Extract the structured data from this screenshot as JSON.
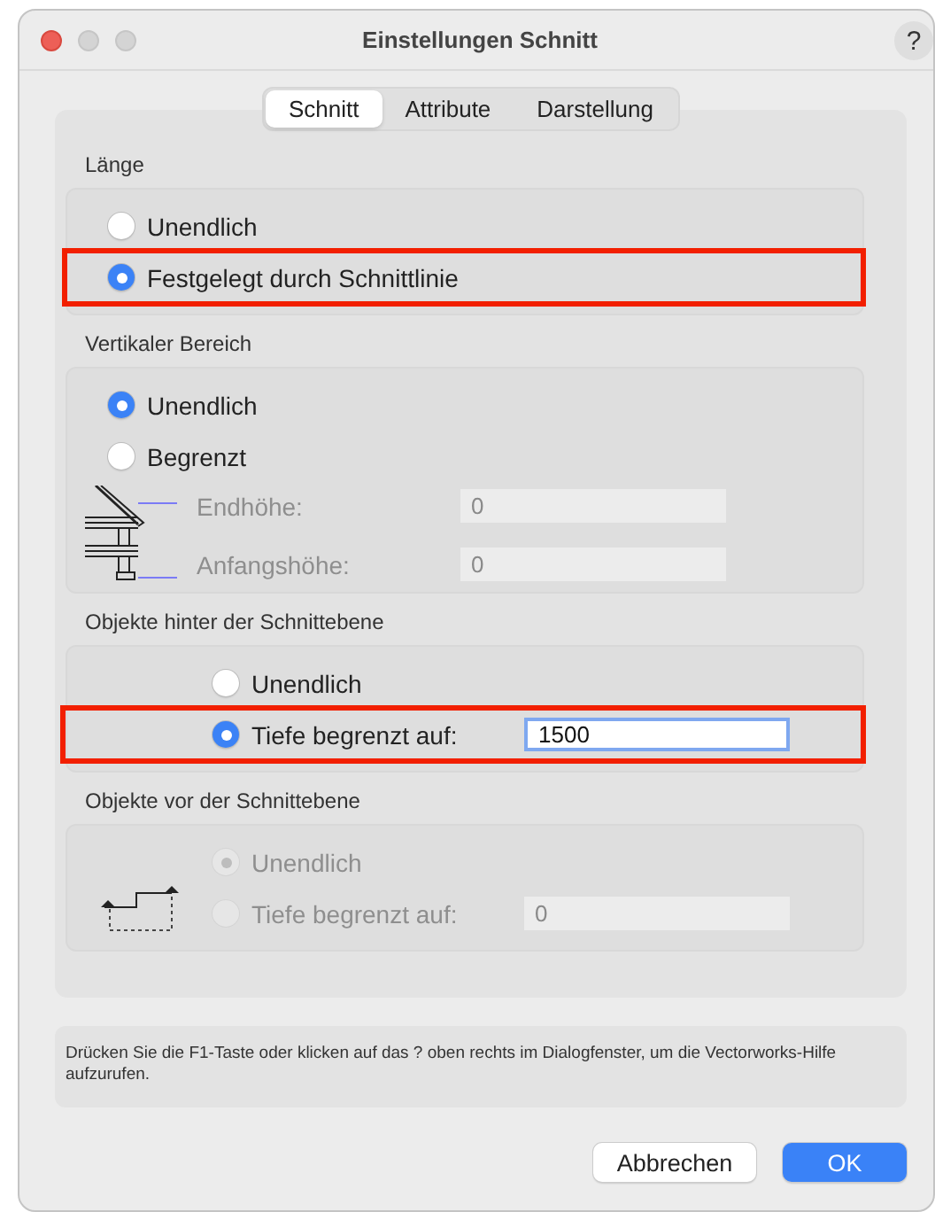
{
  "window": {
    "title": "Einstellungen Schnitt",
    "help_button": "?"
  },
  "tabs": [
    {
      "label": "Schnitt",
      "selected": true
    },
    {
      "label": "Attribute",
      "selected": false
    },
    {
      "label": "Darstellung",
      "selected": false
    }
  ],
  "sections": [
    {
      "label": "Länge",
      "kind": "plain",
      "options": [
        {
          "kind": "radio",
          "label": "Unendlich",
          "selected": false,
          "disabled": false,
          "highlighted": false
        },
        {
          "kind": "radio",
          "label": "Festgelegt durch Schnittlinie",
          "selected": true,
          "disabled": false,
          "highlighted": true
        }
      ]
    },
    {
      "label": "Vertikaler Bereich",
      "kind": "building",
      "options": [
        {
          "kind": "radio",
          "label": "Unendlich",
          "selected": true,
          "disabled": false,
          "highlighted": false
        },
        {
          "kind": "radio",
          "label": "Begrenzt",
          "selected": false,
          "disabled": false,
          "highlighted": false
        },
        {
          "kind": "field",
          "label": "Endhöhe:",
          "value": "0",
          "disabled": true,
          "focused": false,
          "highlighted": false
        },
        {
          "kind": "field",
          "label": "Anfangshöhe:",
          "value": "0",
          "disabled": true,
          "focused": false,
          "highlighted": false
        }
      ]
    },
    {
      "label": "Objekte hinter der Schnittebene",
      "kind": "indented",
      "options": [
        {
          "kind": "radio",
          "label": "Unendlich",
          "selected": false,
          "disabled": false,
          "highlighted": false
        },
        {
          "kind": "radio_field",
          "label": "Tiefe begrenzt auf:",
          "selected": true,
          "disabled": false,
          "value": "1500",
          "focused": true,
          "highlighted": true
        }
      ]
    },
    {
      "label": "Objekte vor der Schnittebene",
      "kind": "step",
      "options": [
        {
          "kind": "radio",
          "label": "Unendlich",
          "selected": true,
          "disabled": true,
          "highlighted": false
        },
        {
          "kind": "radio_field",
          "label": "Tiefe begrenzt auf:",
          "selected": false,
          "disabled": true,
          "value": "0",
          "focused": false,
          "highlighted": false
        }
      ]
    }
  ],
  "help_text": "Drücken Sie die F1-Taste oder klicken auf das ? oben rechts im Dialogfenster, um die Vectorworks-Hilfe aufzurufen.",
  "buttons": [
    {
      "label": "Abbrechen",
      "kind": "default"
    },
    {
      "label": "OK",
      "kind": "primary"
    }
  ]
}
